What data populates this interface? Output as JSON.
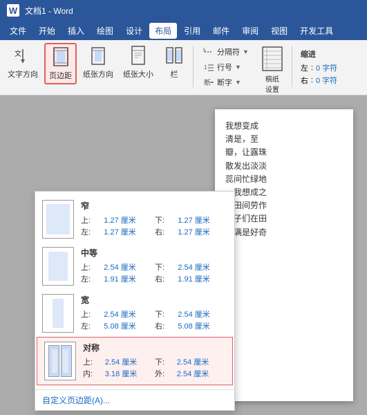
{
  "titleBar": {
    "wordIcon": "W",
    "title": "文档1 - Word"
  },
  "menuBar": {
    "items": [
      "文件",
      "开始",
      "插入",
      "绘图",
      "设计",
      "布局",
      "引用",
      "邮件",
      "审阅",
      "视图",
      "开发工具"
    ],
    "activeItem": "布局"
  },
  "ribbon": {
    "groups": [
      {
        "label": "",
        "buttons": [
          {
            "id": "text-direction",
            "label": "文字方向",
            "icon": "text-dir"
          },
          {
            "id": "margins",
            "label": "页边距",
            "icon": "margins",
            "selected": true
          },
          {
            "id": "orientation",
            "label": "纸张方向",
            "icon": "orientation"
          },
          {
            "id": "paper-size",
            "label": "纸张大小",
            "icon": "paper-size"
          },
          {
            "id": "columns",
            "label": "栏",
            "icon": "columns"
          }
        ]
      }
    ],
    "splitGroup": {
      "label": "稿纸设置",
      "items": [
        "分隔符",
        "行号",
        "断字"
      ]
    },
    "indentGroup": {
      "label": "缩进",
      "leftLabel": "左",
      "leftValue": "0 字符",
      "rightLabel": "右",
      "rightValue": "0 字符"
    }
  },
  "dropdown": {
    "options": [
      {
        "id": "narrow",
        "name": "窄",
        "top": "1.27",
        "topUnit": "厘米",
        "bottom": "1.27",
        "bottomUnit": "厘米",
        "left": "1.27",
        "leftUnit": "厘米",
        "right": "1.27",
        "rightUnit": "厘米",
        "preview": {
          "type": "narrow"
        }
      },
      {
        "id": "medium",
        "name": "中等",
        "top": "2.54",
        "topUnit": "厘米",
        "bottom": "2.54",
        "bottomUnit": "厘米",
        "left": "1.91",
        "leftUnit": "厘米",
        "right": "1.91",
        "rightUnit": "厘米",
        "preview": {
          "type": "medium"
        }
      },
      {
        "id": "wide",
        "name": "宽",
        "top": "2.54",
        "topUnit": "厘米",
        "bottom": "2.54",
        "bottomUnit": "厘米",
        "left": "5.08",
        "leftUnit": "厘米",
        "right": "5.08",
        "rightUnit": "厘米",
        "preview": {
          "type": "wide"
        }
      },
      {
        "id": "mirror",
        "name": "对称",
        "top": "2.54",
        "topUnit": "厘米",
        "bottom": "2.54",
        "bottomUnit": "厘米",
        "inner": "3.18",
        "innerUnit": "厘米",
        "outer": "2.54",
        "outerUnit": "厘米",
        "preview": {
          "type": "mirror"
        },
        "selected": true
      }
    ],
    "customLabel": "自定义页边距(A)..."
  },
  "documentText": [
    "我想变成",
    "清是，至",
    "瓣，让露珠",
    "散发出淡淡",
    "蕊间忙绿地",
    "　我想成之",
    "在田间劳作",
    "孩子们在田",
    "里满是好奇"
  ]
}
